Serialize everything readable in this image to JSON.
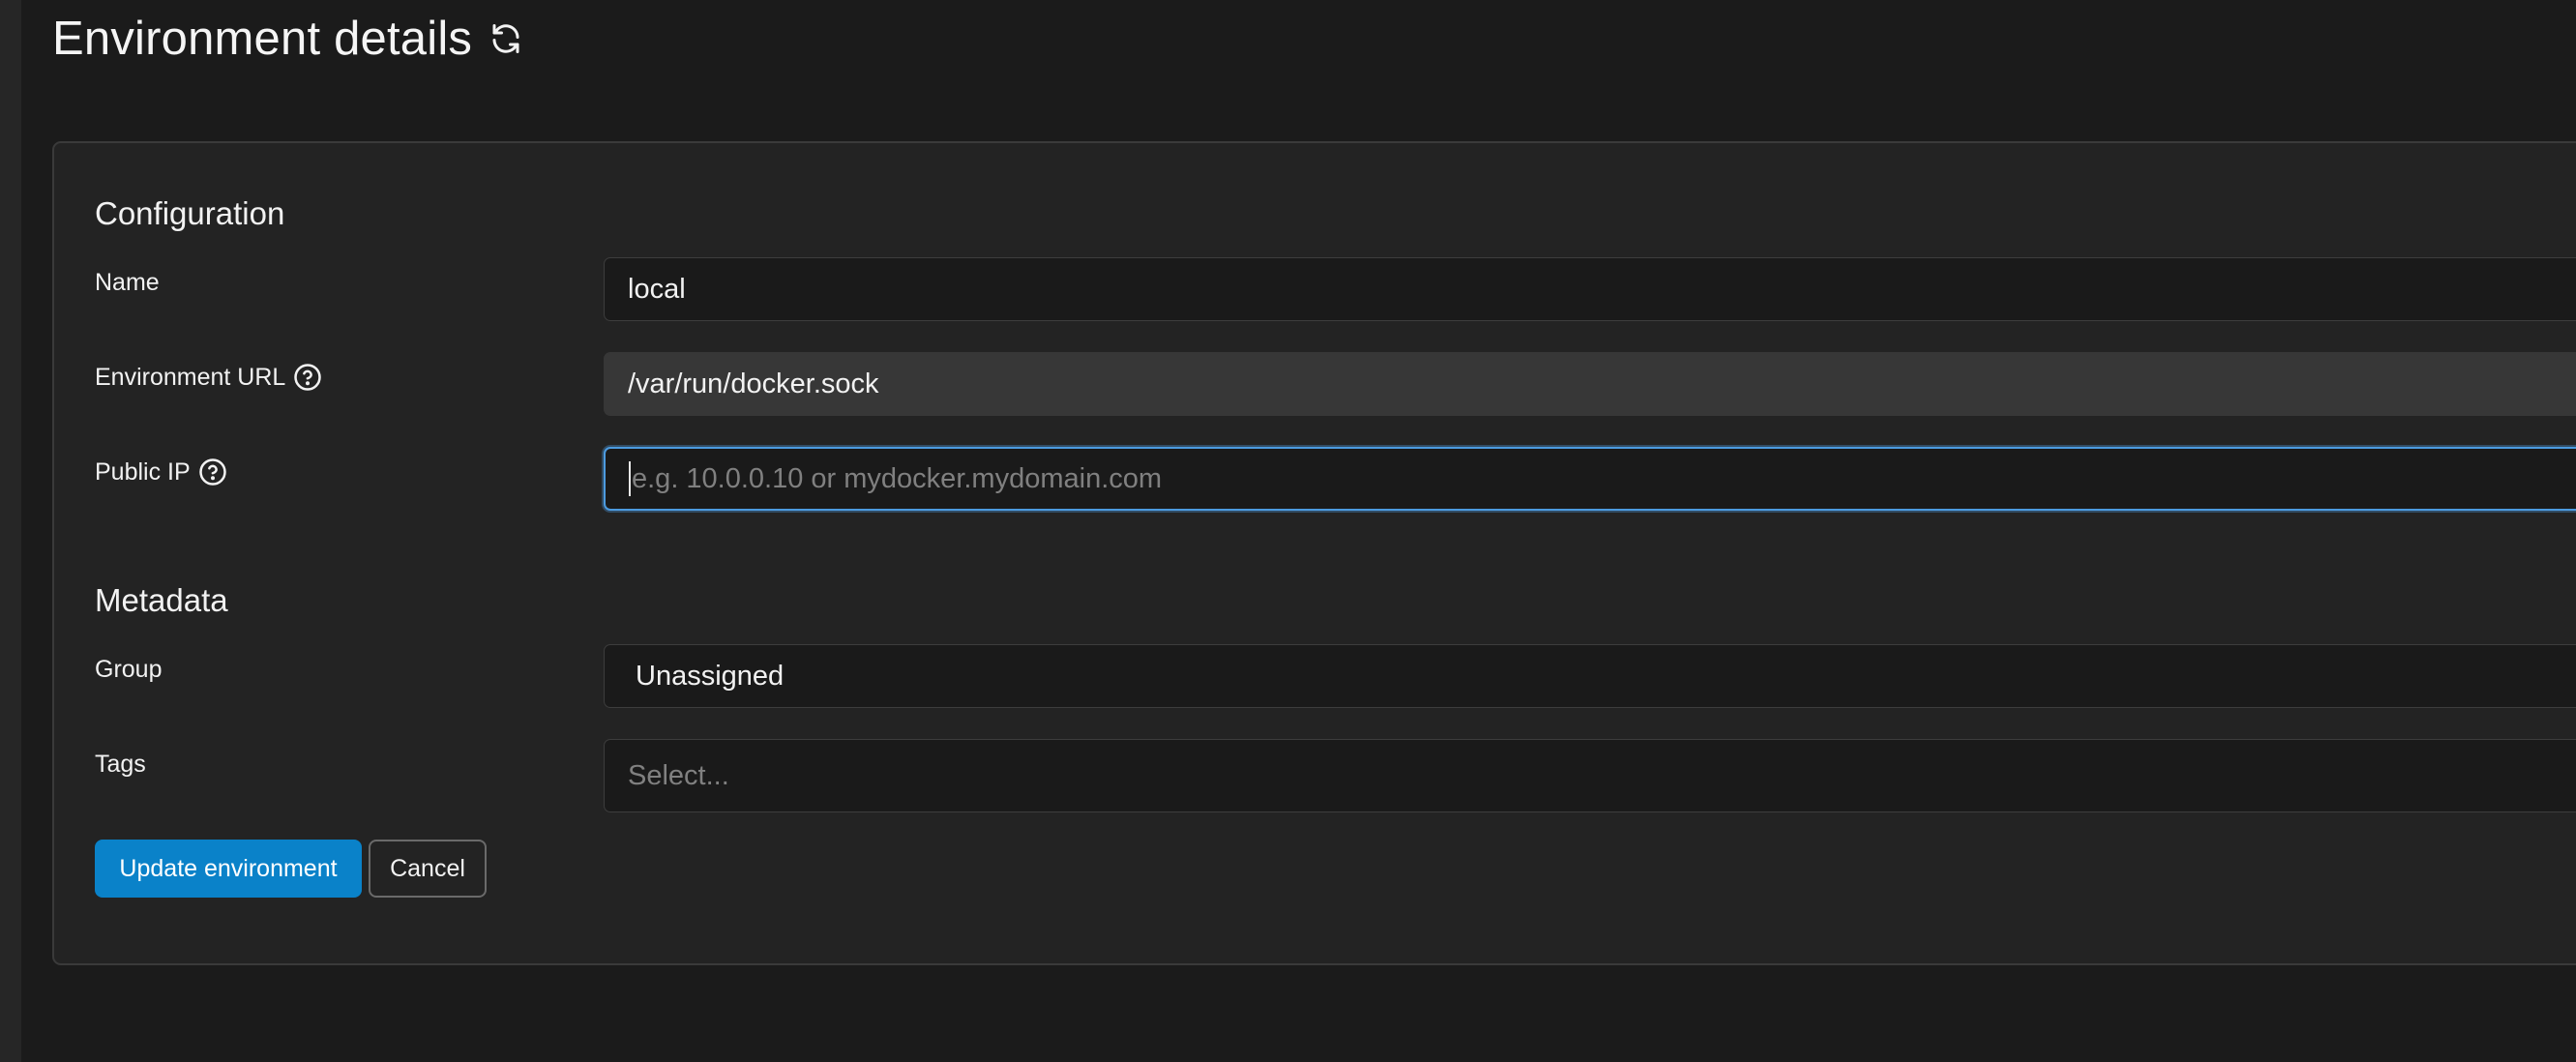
{
  "page": {
    "title": "Environment details"
  },
  "configuration": {
    "section_title": "Configuration",
    "name": {
      "label": "Name",
      "value": "local"
    },
    "environment_url": {
      "label": "Environment URL",
      "value": "/var/run/docker.sock"
    },
    "public_ip": {
      "label": "Public IP",
      "placeholder": "e.g. 10.0.0.10 or mydocker.mydomain.com"
    }
  },
  "metadata": {
    "section_title": "Metadata",
    "group": {
      "label": "Group",
      "value": "Unassigned"
    },
    "tags": {
      "label": "Tags",
      "placeholder": "Select..."
    }
  },
  "actions": {
    "update_label": "Update environment",
    "cancel_label": "Cancel"
  },
  "colors": {
    "primary_button": "#0a82c9",
    "focus_ring": "#4c9be0",
    "background": "#1b1b1b",
    "card_background": "#232323"
  },
  "icons": {
    "refresh": "refresh-icon",
    "help": "help-circle-icon"
  }
}
